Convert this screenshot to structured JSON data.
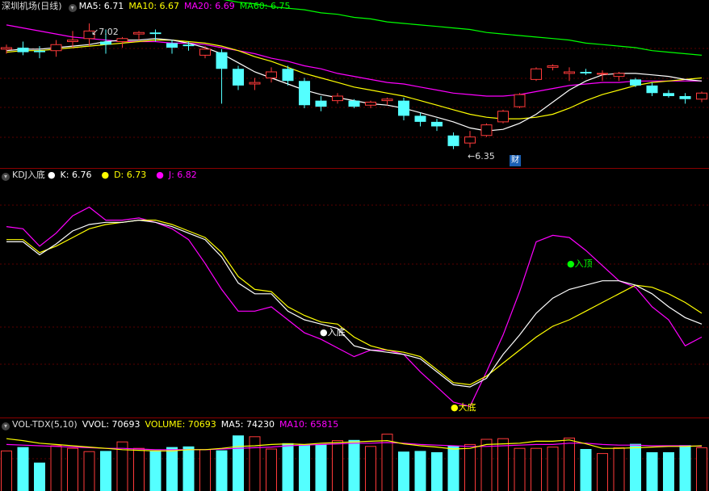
{
  "price_panel": {
    "title": "深圳机场(日线)",
    "ma5_label": "MA5: 6.71",
    "ma10_label": "MA10: 6.67",
    "ma20_label": "MA20: 6.69",
    "ma60_label": "MA60: 6.75",
    "high_label": "7.02",
    "low_label": "6.35",
    "finance_badge": "财",
    "colors": {
      "up": "#ff3a3a",
      "down": "#54ffff",
      "ma5": "#ffffff",
      "ma10": "#ffff00",
      "ma20": "#ff00ff",
      "ma60": "#00ff00"
    }
  },
  "kdj_panel": {
    "title": "KDJ入底",
    "k_label": "K: 6.76",
    "d_label": "D: 6.73",
    "j_label": "J: 6.82",
    "signal_low1": "入底",
    "signal_low2": "大底",
    "signal_top": "入顶"
  },
  "vol_panel": {
    "title": "VOL-TDX(5,10)",
    "vvol_label": "VVOL: 70693",
    "volume_label": "VOLUME: 70693",
    "ma5_label": "MA5: 74230",
    "ma10_label": "MA10: 65815"
  },
  "chart_data": {
    "type": "candlestick",
    "candles": [
      {
        "o": 6.85,
        "h": 6.88,
        "l": 6.82,
        "c": 6.86
      },
      {
        "o": 6.86,
        "h": 6.9,
        "l": 6.81,
        "c": 6.83
      },
      {
        "o": 6.84,
        "h": 6.87,
        "l": 6.79,
        "c": 6.83
      },
      {
        "o": 6.84,
        "h": 6.91,
        "l": 6.8,
        "c": 6.88
      },
      {
        "o": 6.9,
        "h": 6.97,
        "l": 6.86,
        "c": 6.91
      },
      {
        "o": 6.92,
        "h": 7.02,
        "l": 6.87,
        "c": 6.97
      },
      {
        "o": 6.9,
        "h": 6.98,
        "l": 6.82,
        "c": 6.88
      },
      {
        "o": 6.9,
        "h": 6.93,
        "l": 6.86,
        "c": 6.92
      },
      {
        "o": 6.95,
        "h": 6.97,
        "l": 6.91,
        "c": 6.96
      },
      {
        "o": 6.96,
        "h": 6.98,
        "l": 6.9,
        "c": 6.95
      },
      {
        "o": 6.89,
        "h": 6.91,
        "l": 6.82,
        "c": 6.86
      },
      {
        "o": 6.88,
        "h": 6.9,
        "l": 6.84,
        "c": 6.87
      },
      {
        "o": 6.81,
        "h": 6.87,
        "l": 6.79,
        "c": 6.85
      },
      {
        "o": 6.83,
        "h": 6.85,
        "l": 6.49,
        "c": 6.72
      },
      {
        "o": 6.72,
        "h": 6.74,
        "l": 6.58,
        "c": 6.61
      },
      {
        "o": 6.62,
        "h": 6.66,
        "l": 6.58,
        "c": 6.63
      },
      {
        "o": 6.66,
        "h": 6.73,
        "l": 6.63,
        "c": 6.7
      },
      {
        "o": 6.72,
        "h": 6.74,
        "l": 6.61,
        "c": 6.64
      },
      {
        "o": 6.64,
        "h": 6.66,
        "l": 6.46,
        "c": 6.48
      },
      {
        "o": 6.51,
        "h": 6.54,
        "l": 6.44,
        "c": 6.47
      },
      {
        "o": 6.51,
        "h": 6.56,
        "l": 6.49,
        "c": 6.54
      },
      {
        "o": 6.51,
        "h": 6.52,
        "l": 6.46,
        "c": 6.47
      },
      {
        "o": 6.48,
        "h": 6.51,
        "l": 6.46,
        "c": 6.5
      },
      {
        "o": 6.51,
        "h": 6.53,
        "l": 6.48,
        "c": 6.52
      },
      {
        "o": 6.51,
        "h": 6.53,
        "l": 6.38,
        "c": 6.41
      },
      {
        "o": 6.41,
        "h": 6.43,
        "l": 6.34,
        "c": 6.37
      },
      {
        "o": 6.37,
        "h": 6.39,
        "l": 6.31,
        "c": 6.34
      },
      {
        "o": 6.28,
        "h": 6.3,
        "l": 6.19,
        "c": 6.21
      },
      {
        "o": 6.23,
        "h": 6.31,
        "l": 6.2,
        "c": 6.27
      },
      {
        "o": 6.28,
        "h": 6.36,
        "l": 6.27,
        "c": 6.35
      },
      {
        "o": 6.37,
        "h": 6.45,
        "l": 6.36,
        "c": 6.44
      },
      {
        "o": 6.47,
        "h": 6.56,
        "l": 6.46,
        "c": 6.55
      },
      {
        "o": 6.65,
        "h": 6.73,
        "l": 6.64,
        "c": 6.72
      },
      {
        "o": 6.73,
        "h": 6.75,
        "l": 6.71,
        "c": 6.74
      },
      {
        "o": 6.69,
        "h": 6.73,
        "l": 6.64,
        "c": 6.7
      },
      {
        "o": 6.7,
        "h": 6.72,
        "l": 6.68,
        "c": 6.69
      },
      {
        "o": 6.69,
        "h": 6.71,
        "l": 6.64,
        "c": 6.69
      },
      {
        "o": 6.67,
        "h": 6.7,
        "l": 6.64,
        "c": 6.69
      },
      {
        "o": 6.65,
        "h": 6.66,
        "l": 6.6,
        "c": 6.61
      },
      {
        "o": 6.61,
        "h": 6.63,
        "l": 6.54,
        "c": 6.56
      },
      {
        "o": 6.56,
        "h": 6.58,
        "l": 6.53,
        "c": 6.54
      },
      {
        "o": 6.54,
        "h": 6.56,
        "l": 6.49,
        "c": 6.52
      },
      {
        "o": 6.52,
        "h": 6.57,
        "l": 6.5,
        "c": 6.56
      }
    ],
    "ma5": [
      6.84,
      6.85,
      6.85,
      6.86,
      6.87,
      6.88,
      6.9,
      6.91,
      6.91,
      6.92,
      6.91,
      6.89,
      6.86,
      6.82,
      6.76,
      6.7,
      6.66,
      6.62,
      6.58,
      6.55,
      6.53,
      6.51,
      6.49,
      6.48,
      6.46,
      6.43,
      6.4,
      6.37,
      6.33,
      6.31,
      6.32,
      6.36,
      6.42,
      6.5,
      6.58,
      6.64,
      6.68,
      6.69,
      6.69,
      6.68,
      6.67,
      6.65,
      6.64
    ],
    "ma10": [
      6.83,
      6.84,
      6.84,
      6.85,
      6.86,
      6.87,
      6.88,
      6.89,
      6.9,
      6.91,
      6.91,
      6.9,
      6.89,
      6.87,
      6.84,
      6.8,
      6.77,
      6.73,
      6.69,
      6.66,
      6.63,
      6.6,
      6.58,
      6.56,
      6.54,
      6.51,
      6.48,
      6.45,
      6.42,
      6.4,
      6.39,
      6.39,
      6.4,
      6.42,
      6.46,
      6.51,
      6.55,
      6.58,
      6.61,
      6.63,
      6.64,
      6.65,
      6.66
    ],
    "ma20": [
      7.01,
      6.99,
      6.97,
      6.95,
      6.93,
      6.92,
      6.91,
      6.9,
      6.9,
      6.9,
      6.89,
      6.89,
      6.88,
      6.86,
      6.84,
      6.82,
      6.79,
      6.77,
      6.74,
      6.72,
      6.69,
      6.67,
      6.65,
      6.63,
      6.62,
      6.6,
      6.58,
      6.56,
      6.55,
      6.54,
      6.54,
      6.55,
      6.57,
      6.59,
      6.61,
      6.62,
      6.63,
      6.63,
      6.64,
      6.64,
      6.64,
      6.64,
      6.64
    ],
    "ma60": [
      7.26,
      7.26,
      7.26,
      7.25,
      7.25,
      7.25,
      7.24,
      7.24,
      7.23,
      7.22,
      7.21,
      7.2,
      7.19,
      7.18,
      7.16,
      7.15,
      7.13,
      7.12,
      7.11,
      7.09,
      7.08,
      7.06,
      7.05,
      7.03,
      7.02,
      7.01,
      7.0,
      6.99,
      6.98,
      6.96,
      6.95,
      6.94,
      6.93,
      6.92,
      6.91,
      6.89,
      6.88,
      6.87,
      6.86,
      6.84,
      6.83,
      6.82,
      6.81
    ],
    "price_range": [
      6.14,
      7.1
    ],
    "kdj": {
      "K": [
        68,
        68,
        62,
        67,
        73,
        76,
        77,
        77,
        78,
        77,
        75,
        72,
        69,
        61,
        49,
        44,
        44,
        36,
        32,
        30,
        28,
        20,
        18,
        17,
        16,
        14,
        8,
        2,
        1,
        5,
        16,
        25,
        35,
        42,
        46,
        48,
        50,
        50,
        48,
        44,
        38,
        33,
        30
      ],
      "D": [
        69,
        69,
        63,
        66,
        70,
        74,
        76,
        77,
        78,
        78,
        76,
        73,
        70,
        63,
        52,
        46,
        45,
        38,
        34,
        31,
        30,
        24,
        20,
        18,
        17,
        15,
        9,
        3,
        2,
        6,
        12,
        18,
        24,
        29,
        32,
        36,
        40,
        44,
        48,
        47,
        44,
        40,
        35
      ],
      "J": [
        75,
        74,
        66,
        72,
        80,
        84,
        78,
        78,
        79,
        77,
        74,
        69,
        58,
        46,
        36,
        36,
        38,
        32,
        26,
        23,
        19,
        15,
        18,
        18,
        16,
        8,
        1,
        -6,
        -8,
        8,
        25,
        45,
        68,
        71,
        70,
        64,
        57,
        50,
        47,
        38,
        32,
        20,
        24
      ],
      "range": [
        -12,
        95
      ]
    },
    "volume": {
      "values": [
        62,
        68,
        44,
        70,
        66,
        61,
        62,
        76,
        66,
        63,
        68,
        69,
        64,
        63,
        86,
        84,
        65,
        74,
        72,
        72,
        78,
        79,
        69,
        88,
        61,
        62,
        60,
        70,
        72,
        80,
        81,
        66,
        66,
        68,
        82,
        65,
        58,
        67,
        73,
        60,
        60,
        71,
        67
      ],
      "ma5": [
        81,
        78,
        74,
        72,
        70,
        68,
        66,
        64,
        63,
        62,
        62,
        64,
        64,
        66,
        69,
        70,
        72,
        73,
        72,
        74,
        75,
        76,
        77,
        78,
        73,
        70,
        68,
        65,
        66,
        72,
        73,
        74,
        77,
        77,
        79,
        73,
        66,
        66,
        67,
        68,
        69,
        69,
        70
      ],
      "ma10": [
        72,
        71,
        70,
        69,
        68,
        67,
        66,
        66,
        65,
        64,
        64,
        64,
        64,
        65,
        66,
        67,
        68,
        70,
        71,
        72,
        73,
        74,
        74,
        75,
        74,
        72,
        71,
        70,
        69,
        69,
        70,
        71,
        72,
        72,
        74,
        74,
        72,
        71,
        71,
        70,
        70,
        70,
        69
      ],
      "range": [
        0,
        95
      ]
    }
  }
}
